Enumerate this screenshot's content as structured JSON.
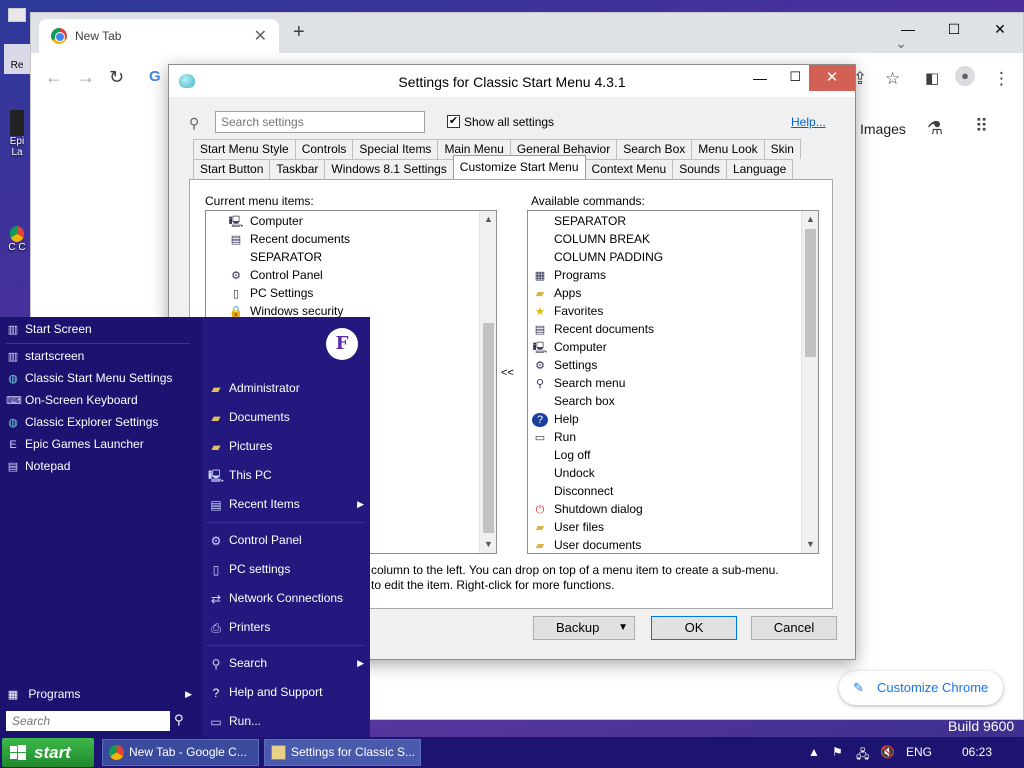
{
  "desktop": {
    "icons": [
      "Re",
      "Epi La",
      "C C"
    ],
    "build_text": "Build 9600"
  },
  "chrome": {
    "tab_title": "New Tab",
    "new_tab": "+",
    "images_link": "Images",
    "customize_label": "Customize Chrome",
    "google_letter": "G"
  },
  "dialog": {
    "title": "Settings for Classic Start Menu 4.3.1",
    "search_placeholder": "Search settings",
    "show_all_label": "Show all settings",
    "show_all_checked": true,
    "help_label": "Help...",
    "tabs_row1": [
      "Start Menu Style",
      "Controls",
      "Special Items",
      "Main Menu",
      "General Behavior",
      "Search Box",
      "Menu Look",
      "Skin"
    ],
    "tabs_row2": [
      "Start Button",
      "Taskbar",
      "Windows 8.1 Settings",
      "Customize Start Menu",
      "Context Menu",
      "Sounds",
      "Language"
    ],
    "active_tab": "Customize Start Menu",
    "current_label": "Current menu items:",
    "available_label": "Available commands:",
    "current_items": [
      {
        "label": "Computer",
        "icon": "computer-icon"
      },
      {
        "label": "Recent documents",
        "icon": "recent-docs-icon"
      },
      {
        "label": "SEPARATOR",
        "icon": ""
      },
      {
        "label": "Control Panel",
        "icon": "control-panel-icon"
      },
      {
        "label": "PC Settings",
        "icon": "page-icon"
      },
      {
        "label": "Windows security",
        "icon": "lock-icon"
      }
    ],
    "available_items": [
      {
        "label": "SEPARATOR",
        "icon": ""
      },
      {
        "label": "COLUMN BREAK",
        "icon": ""
      },
      {
        "label": "COLUMN PADDING",
        "icon": ""
      },
      {
        "label": "Programs",
        "icon": "programs-icon"
      },
      {
        "label": "Apps",
        "icon": "folder-icon"
      },
      {
        "label": "Favorites",
        "icon": "star-icon"
      },
      {
        "label": "Recent documents",
        "icon": "recent-docs-icon"
      },
      {
        "label": "Computer",
        "icon": "computer-icon"
      },
      {
        "label": "Settings",
        "icon": "settings-icon"
      },
      {
        "label": "Search menu",
        "icon": "search-icon"
      },
      {
        "label": "Search box",
        "icon": ""
      },
      {
        "label": "Help",
        "icon": "help-icon"
      },
      {
        "label": "Run",
        "icon": "run-icon"
      },
      {
        "label": "Log off",
        "icon": ""
      },
      {
        "label": "Undock",
        "icon": ""
      },
      {
        "label": "Disconnect",
        "icon": ""
      },
      {
        "label": "Shutdown dialog",
        "icon": "shutdown-icon"
      },
      {
        "label": "User files",
        "icon": "folder-icon"
      },
      {
        "label": "User documents",
        "icon": "folder-icon"
      }
    ],
    "move_button": "<<",
    "hint_line1": "column to the left. You can drop on top of a menu item to create a sub-menu.",
    "hint_line2": "to edit the item. Right-click for more functions.",
    "backup_label": "Backup",
    "ok_label": "OK",
    "cancel_label": "Cancel"
  },
  "start_menu": {
    "left_items": [
      {
        "label": "Start Screen",
        "icon": "start-screen-icon"
      },
      {
        "label": "startscreen",
        "icon": "start-screen-icon"
      },
      {
        "label": "Classic Start Menu Settings",
        "icon": "shell-icon"
      },
      {
        "label": "On-Screen Keyboard",
        "icon": "keyboard-icon"
      },
      {
        "label": "Classic Explorer Settings",
        "icon": "shell-icon"
      },
      {
        "label": "Epic Games Launcher",
        "icon": "epic-icon"
      },
      {
        "label": "Notepad",
        "icon": "notepad-icon"
      }
    ],
    "programs_label": "Programs",
    "search_placeholder": "Search",
    "avatar_letter": "F",
    "right_items": [
      {
        "label": "Administrator",
        "icon": "user-folder-icon",
        "sub": false
      },
      {
        "label": "Documents",
        "icon": "documents-icon",
        "sub": false
      },
      {
        "label": "Pictures",
        "icon": "pictures-icon",
        "sub": false
      },
      {
        "label": "This PC",
        "icon": "computer-icon",
        "sub": false
      },
      {
        "label": "Recent Items",
        "icon": "recent-docs-icon",
        "sub": true
      },
      {
        "label": "Control Panel",
        "icon": "control-panel-icon",
        "sub": false
      },
      {
        "label": "PC settings",
        "icon": "page-icon",
        "sub": false
      },
      {
        "label": "Network Connections",
        "icon": "network-icon",
        "sub": false
      },
      {
        "label": "Printers",
        "icon": "printer-icon",
        "sub": false
      },
      {
        "label": "Search",
        "icon": "search-icon",
        "sub": true
      },
      {
        "label": "Help and Support",
        "icon": "help-icon",
        "sub": false
      },
      {
        "label": "Run...",
        "icon": "run-icon",
        "sub": false
      }
    ]
  },
  "taskbar": {
    "start_label": "start",
    "buttons": [
      {
        "label": "New Tab - Google C...",
        "icon": "chrome-icon"
      },
      {
        "label": "Settings for Classic S...",
        "icon": "settings-window-icon"
      }
    ],
    "lang": "ENG",
    "time": "06:23"
  }
}
